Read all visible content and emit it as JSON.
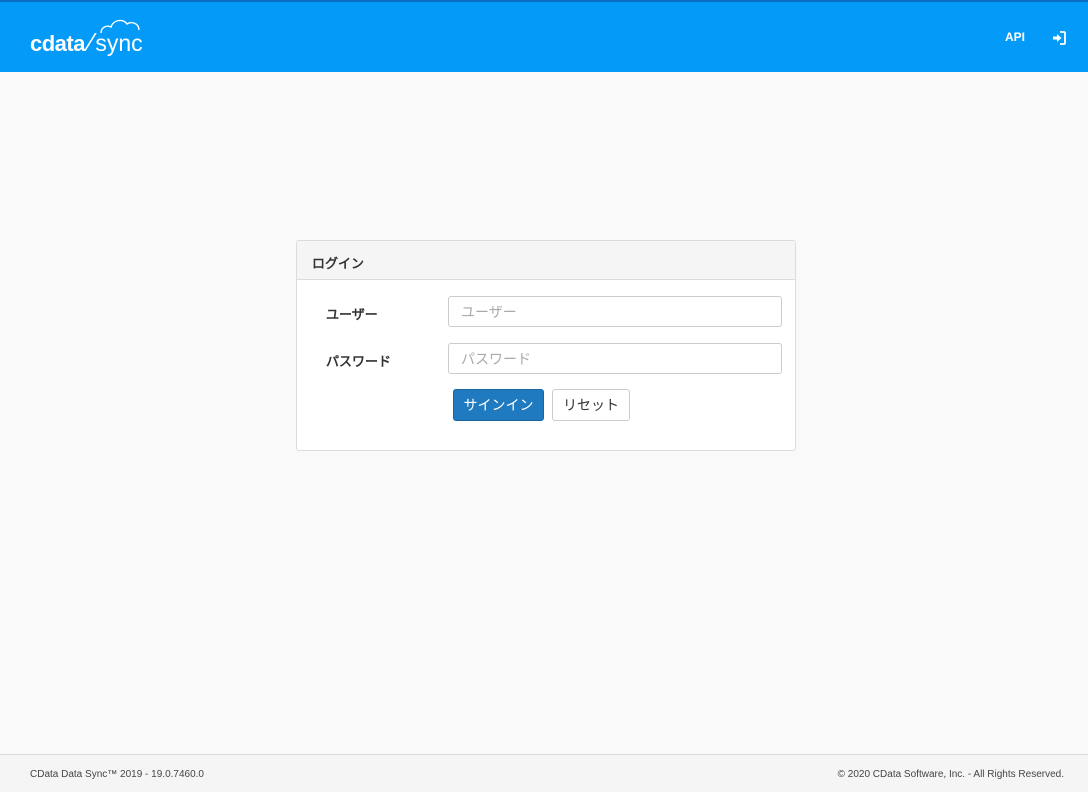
{
  "header": {
    "logo_cdata": "cdata",
    "logo_sync": "sync",
    "nav_api": "API",
    "login_icon": "sign-in-icon",
    "color": "#039bf7"
  },
  "login": {
    "title": "ログイン",
    "user_label": "ユーザー",
    "user_placeholder": "ユーザー",
    "user_value": "",
    "password_label": "パスワード",
    "password_placeholder": "パスワード",
    "password_value": "",
    "signin_label": "サインイン",
    "reset_label": "リセット",
    "primary_color": "#1f7abf"
  },
  "footer": {
    "version_text": "CData Data Sync™ 2019 - 19.0.7460.0",
    "copyright_text": "© 2020 CData Software, Inc. - All Rights Reserved."
  }
}
